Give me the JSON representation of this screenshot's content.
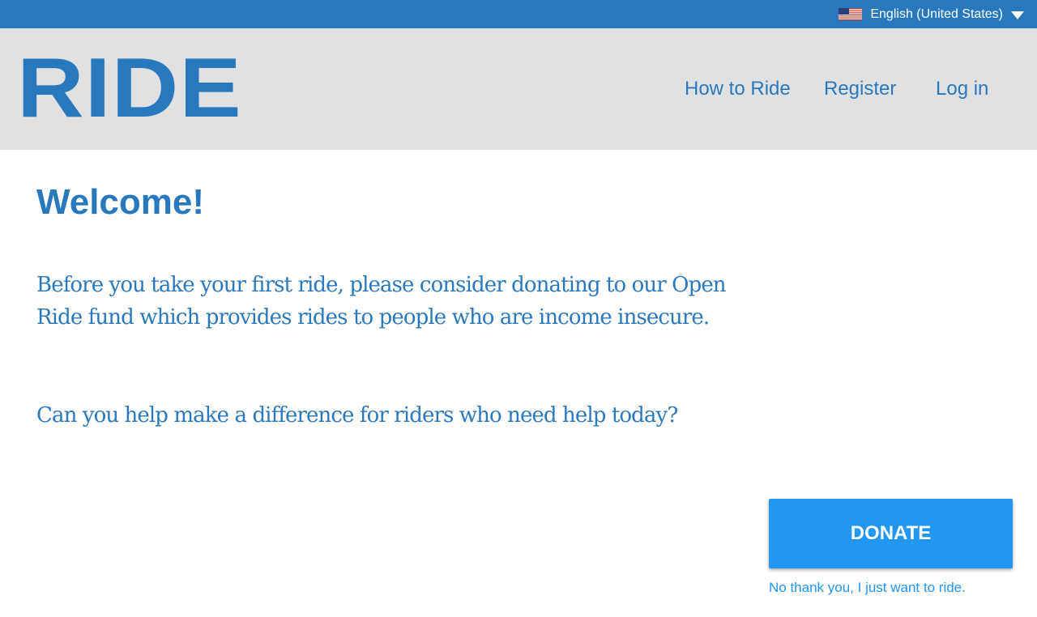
{
  "topbar": {
    "language": "English (United States)",
    "flag_icon": "us-flag-icon"
  },
  "header": {
    "logo": "RIDE",
    "nav": {
      "how_to_ride": "How to Ride",
      "register": "Register",
      "log_in": "Log in"
    }
  },
  "main": {
    "title": "Welcome!",
    "paragraph1": "Before you take your first ride, please consider donating to our Open Ride fund which provides rides to people who are income insecure.",
    "paragraph2": "Can you help make a difference for riders who need help today?",
    "donate_label": "DONATE",
    "decline_label": "No thank you, I just want to ride."
  },
  "colors": {
    "brand": "#2778bd",
    "header_bg": "#e1e1e1",
    "button": "#2196f3"
  }
}
